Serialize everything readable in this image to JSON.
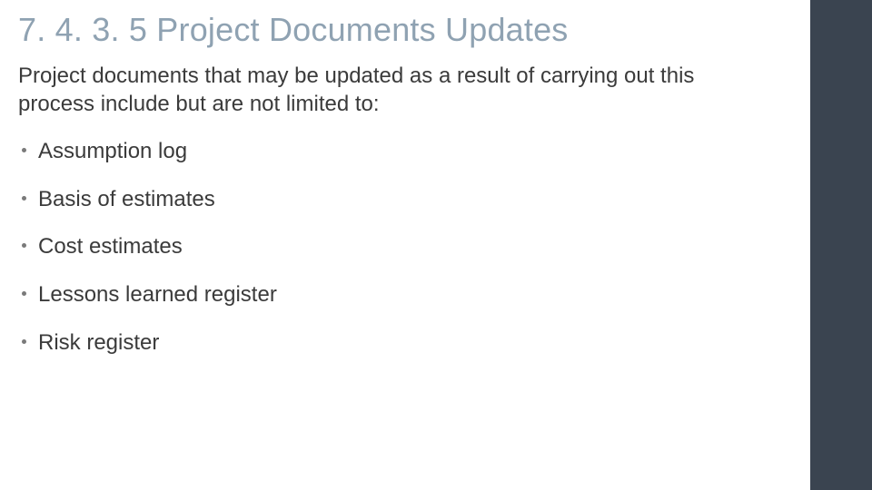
{
  "slide": {
    "title": "7. 4. 3. 5 Project Documents Updates",
    "intro": "Project documents that may be updated as a result of carrying out this process include but are not limited to:",
    "bullets": [
      "Assumption log",
      "Basis of estimates",
      "Cost estimates",
      "Lessons learned register",
      "Risk register"
    ]
  }
}
